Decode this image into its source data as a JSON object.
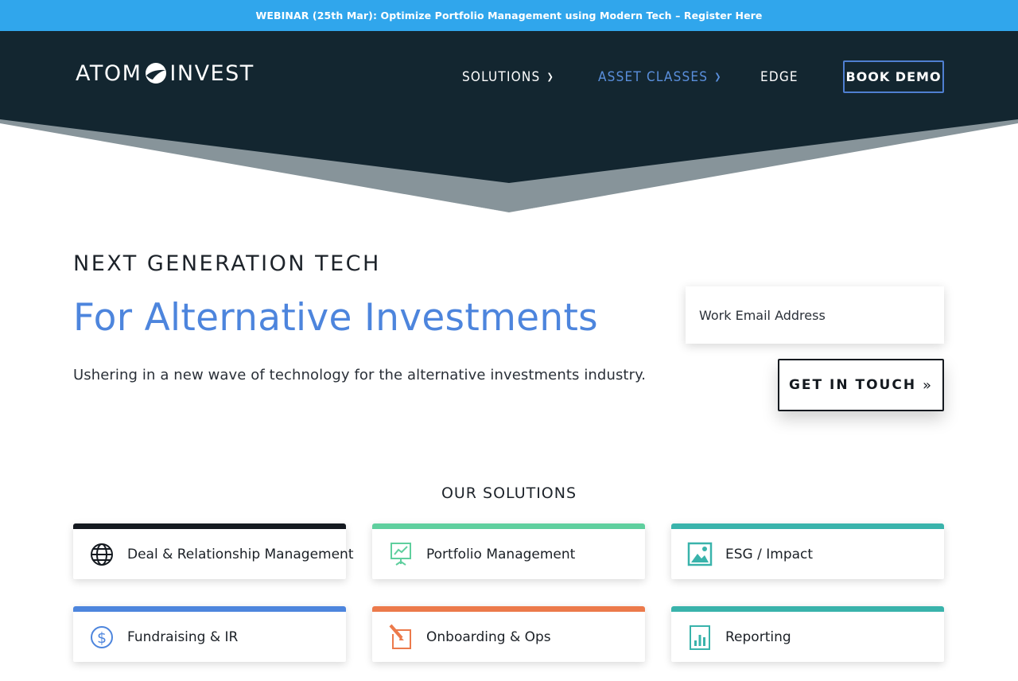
{
  "banner": {
    "text": "WEBINAR (25th Mar): Optimize Portfolio Management using Modern Tech – Register Here"
  },
  "header": {
    "logo_left": "ATOM",
    "logo_right": "INVEST",
    "nav": [
      {
        "label": "SOLUTIONS"
      },
      {
        "label": "ASSET CLASSES"
      },
      {
        "label": "EDGE"
      }
    ],
    "book_demo_label": "BOOK DEMO"
  },
  "hero": {
    "eyebrow": "NEXT GENERATION TECH",
    "headline": "For Alternative Investments",
    "subtext": "Ushering in a new wave of technology for the alternative investments industry.",
    "email_placeholder": "Work Email Address",
    "cta_label": "GET IN TOUCH",
    "cta_arrows": "»"
  },
  "solutions": {
    "title": "OUR SOLUTIONS",
    "cards": [
      {
        "label": "Deal & Relationship Management",
        "icon": "globe-icon",
        "accent": "#14191f"
      },
      {
        "label": "Portfolio Management",
        "icon": "presentation-chart-icon",
        "accent": "#5fcf9e"
      },
      {
        "label": "ESG / Impact",
        "icon": "landscape-image-icon",
        "accent": "#39b3ab"
      },
      {
        "label": "Fundraising & IR",
        "icon": "dollar-circle-icon",
        "accent": "#4d85dd"
      },
      {
        "label": "Onboarding & Ops",
        "icon": "edit-pencil-icon",
        "accent": "#ec7a4b"
      },
      {
        "label": "Reporting",
        "icon": "bar-report-icon",
        "accent": "#39b3ab"
      }
    ]
  },
  "colors": {
    "banner": "#30a6ec",
    "header_dark": "#132630",
    "header_gray": "#87949a",
    "accent_blue": "#4d85dd"
  }
}
